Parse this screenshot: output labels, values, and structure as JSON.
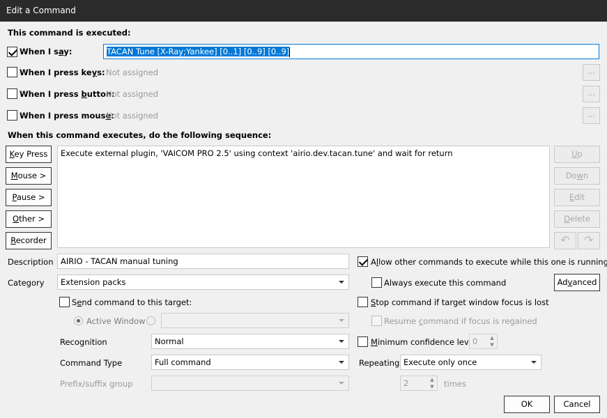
{
  "window": {
    "title": "Edit a Command"
  },
  "section_executed": "This command is executed:",
  "triggers": {
    "say": {
      "label": "When I say:",
      "checked": true,
      "value": "TACAN Tune [X-Ray;Yankee] [0..1] [0..9] [0..9]"
    },
    "keys": {
      "label": "When I press keys:",
      "checked": false,
      "value": "Not assigned",
      "browse": "..."
    },
    "button": {
      "label": "When I press button:",
      "checked": false,
      "value": "Not assigned",
      "browse": "..."
    },
    "mouse": {
      "label": "When I press mouse:",
      "checked": false,
      "value": "Not assigned",
      "browse": "..."
    }
  },
  "section_sequence": "When this command executes, do the following sequence:",
  "left_buttons": {
    "key_press": "Key Press",
    "mouse": "Mouse >",
    "pause": "Pause >",
    "other": "Other >",
    "recorder": "Recorder"
  },
  "sequence_items": [
    "Execute external plugin, 'VAICOM PRO 2.5' using context 'airio.dev.tacan.tune' and wait for return"
  ],
  "right_buttons": {
    "up": "Up",
    "down": "Down",
    "edit": "Edit",
    "delete": "Delete"
  },
  "description": {
    "label": "Description",
    "value": "AIRIO - TACAN manual tuning"
  },
  "category": {
    "label": "Category",
    "value": "Extension packs"
  },
  "send_target": {
    "label": "Send command to this target:",
    "checked": false,
    "active_window": "Active Window",
    "target_value": ""
  },
  "recognition": {
    "label": "Recognition",
    "value": "Normal"
  },
  "command_type": {
    "label": "Command Type",
    "value": "Full command"
  },
  "prefix_suffix": {
    "label": "Prefix/suffix group",
    "value": ""
  },
  "options": {
    "allow_other": {
      "label": "Allow other commands to execute while this one is running",
      "checked": true
    },
    "always_execute": {
      "label": "Always execute this command",
      "checked": false
    },
    "advanced": "Advanced",
    "stop_focus": {
      "label": "Stop command if target window focus is lost",
      "checked": false
    },
    "resume_focus": {
      "label": "Resume command if focus is regained",
      "checked": false
    },
    "min_confidence": {
      "label": "Minimum confidence level",
      "checked": false,
      "value": "0"
    }
  },
  "repeating": {
    "label": "Repeating",
    "value": "Execute only once",
    "times_value": "2",
    "times_label": "times"
  },
  "footer": {
    "ok": "OK",
    "cancel": "Cancel"
  }
}
